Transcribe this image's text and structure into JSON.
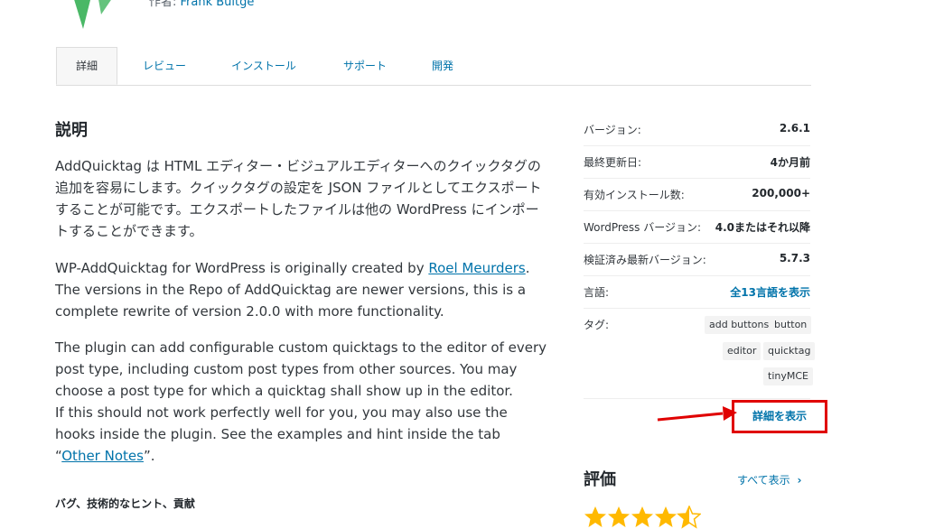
{
  "header": {
    "author_prefix": "作者: ",
    "author_name": "Frank Bültge"
  },
  "tabs": [
    {
      "label": "詳細",
      "active": true
    },
    {
      "label": "レビュー"
    },
    {
      "label": "インストール"
    },
    {
      "label": "サポート"
    },
    {
      "label": "開発"
    }
  ],
  "main": {
    "title": "説明",
    "p1": "AddQuicktag は HTML エディター・ビジュアルエディターへのクイックタグの追加を容易にします。クイックタグの設定を JSON ファイルとしてエクスポートすることが可能です。エクスポートしたファイルは他の WordPress にインポートすることができます。",
    "p2_before": "WP-AddQuicktag for WordPress is originally created by ",
    "p2_link": "Roel Meurders",
    "p2_after": ". The versions in the Repo of AddQuicktag are newer versions, this is a complete rewrite of version 2.0.0 with more functionality.",
    "p3_line1": "The plugin can add configurable custom quicktags to the editor of every post type, including custom post types from other sources. You may choose a post type for which a quicktag shall show up in the editor.",
    "p3_line2_before": "If this should not work perfectly well for you, you may also use the hooks inside the plugin. See the examples and hint inside the tab “",
    "p3_link": "Other Notes",
    "p3_line2_after": "”.",
    "subheading": "バグ、技術的なヒント、貢献"
  },
  "sidebar": {
    "meta": [
      {
        "label": "バージョン:",
        "value": "2.6.1"
      },
      {
        "label": "最終更新日:",
        "value": "4か月前"
      },
      {
        "label": "有効インストール数:",
        "value": "200,000+"
      },
      {
        "label": "WordPress バージョン:",
        "value": "4.0またはそれ以降"
      },
      {
        "label": "検証済み最新バージョン:",
        "value": "5.7.3"
      },
      {
        "label": "言語:",
        "value": "全13言語を表示"
      }
    ],
    "tags_label": "タグ:",
    "tags": [
      "add buttons",
      "button",
      "editor",
      "quicktag",
      "tinyMCE"
    ],
    "details_link": "詳細を表示",
    "ratings_title": "評価",
    "see_all": "すべて表示",
    "see_all_chevron": "›",
    "rating": 4.5
  },
  "colors": {
    "link": "#0073aa",
    "highlight": "#e00000",
    "star": "#ffb900",
    "logo": "#4ab866"
  }
}
